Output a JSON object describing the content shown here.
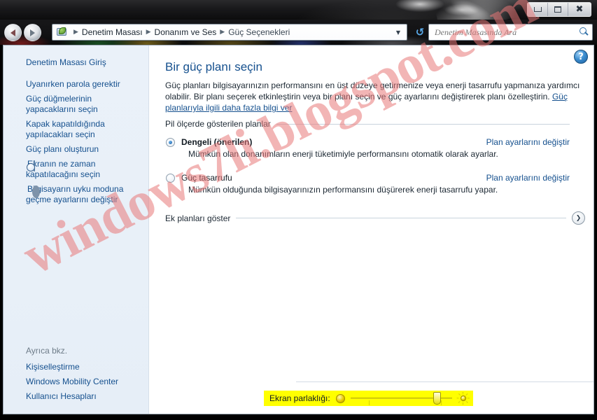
{
  "window": {
    "controls": {
      "minimize": "Simge Durumuna Küçült",
      "maximize": "Ekranı Kapla",
      "close": "Kapat"
    }
  },
  "nav": {
    "back": "Geri",
    "forward": "İleri",
    "refresh": "Yenile",
    "breadcrumb_icon": "control-panel-icon",
    "breadcrumb": [
      "Denetim Masası",
      "Donanım ve Ses",
      "Güç Seçenekleri"
    ],
    "breadcrumb_separator": "▶",
    "dropdown_glyph": "▼"
  },
  "search": {
    "placeholder": "Denetim Masasında Ara",
    "value": "",
    "icon": "search-icon"
  },
  "sidebar": {
    "home_link": "Denetim Masası Giriş",
    "items": [
      {
        "label": "Uyanırken parola gerektir",
        "icon": ""
      },
      {
        "label": "Güç düğmelerinin yapacaklarını seçin",
        "icon": ""
      },
      {
        "label": "Kapak kapatıldığında yapılacakları seçin",
        "icon": ""
      },
      {
        "label": "Güç planı oluşturun",
        "icon": ""
      },
      {
        "label": "Ekranın ne zaman kapatılacağını seçin",
        "icon": "clock-monitor-icon"
      },
      {
        "label": "Bilgisayarın uyku moduna geçme ayarlarını değiştir",
        "icon": "moon-icon"
      }
    ],
    "see_also_heading": "Ayrıca bkz.",
    "see_also": [
      "Kişiselleştirme",
      "Windows Mobility Center",
      "Kullanıcı Hesapları"
    ]
  },
  "content": {
    "help_icon": "help-icon",
    "title": "Bir güç planı seçin",
    "description": "Güç planları bilgisayarınızın performansını en üst düzeye getirmenize veya enerji tasarrufu yapmanıza yardımcı olabilir. Bir planı seçerek etkinleştirin veya bir planı seçin ve güç ayarlarını değiştirerek planı özelleştirin.",
    "description_link": "Güç planlarıyla ilgili daha fazla bilgi ver",
    "group_label": "Pil ölçerde gösterilen planlar",
    "plans": [
      {
        "name": "Dengeli (önerilen)",
        "selected": true,
        "description": "Mümkün olan donanımların enerji tüketimiyle performansını otomatik olarak ayarlar.",
        "change_link": "Plan ayarlarını değiştir"
      },
      {
        "name": "Güç tasarrufu",
        "selected": false,
        "description": "Mümkün olduğunda bilgisayarınızın performansını düşürerek enerji tasarrufu yapar.",
        "change_link": "Plan ayarlarını değiştir"
      }
    ],
    "show_more_label": "Ek planları göster",
    "show_more_glyph": "❯"
  },
  "brightness": {
    "label": "Ekran parlaklığı:",
    "dim_icon": "dim-brightness-icon",
    "bright_icon": "sun-icon",
    "value": 88,
    "highlight_color": "#ffff00"
  },
  "watermark": {
    "text": "windows7li.blogspot.com"
  },
  "colors": {
    "link": "#15508e",
    "sidebar_bg": "#e8f0f8",
    "content_bg": "#ffffff",
    "highlight": "#ffff00"
  }
}
